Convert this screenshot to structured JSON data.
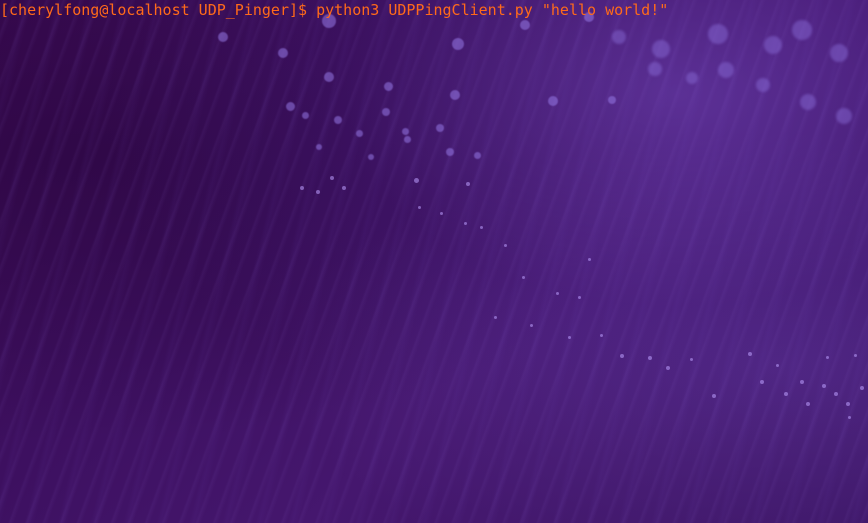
{
  "terminal": {
    "prompt": "[cherylfong@localhost UDP_Pinger]$ ",
    "command": "python3 UDPPingClient.py \"hello world!\"",
    "text_color": "#ff6a1a",
    "background_color": "#3a0f55"
  }
}
